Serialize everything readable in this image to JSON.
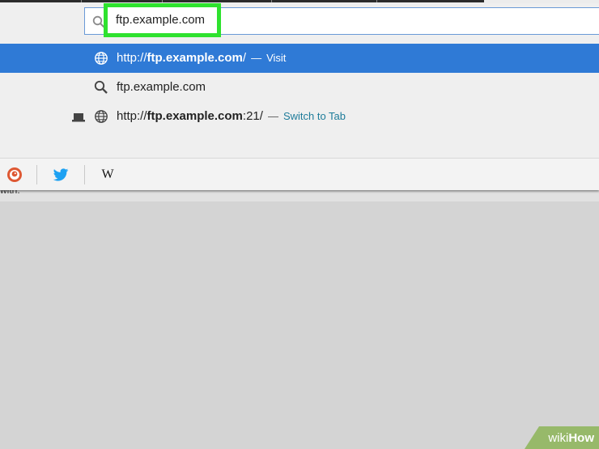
{
  "url_bar": {
    "value": "ftp.example.com",
    "icon": "search-icon"
  },
  "suggestions": [
    {
      "icon": "globe-icon",
      "prefix": "http://",
      "bold": "ftp.example.com",
      "suffix": "/",
      "separator": "—",
      "action": "Visit",
      "selected": true
    },
    {
      "icon": "search-icon",
      "text": "ftp.example.com",
      "selected": false
    },
    {
      "icon": "globe-icon",
      "extra_icon": "tab-icon",
      "prefix": "http://",
      "bold": "ftp.example.com",
      "suffix": ":21/",
      "separator": "—",
      "action": "Switch to Tab",
      "selected": false
    }
  ],
  "search_with": {
    "label": "with:",
    "engines": [
      {
        "name": "duckduckgo",
        "icon": "duckduckgo-icon"
      },
      {
        "name": "twitter",
        "icon": "twitter-bird-icon"
      },
      {
        "name": "wikipedia",
        "icon": "wikipedia-icon",
        "letter": "W"
      }
    ]
  },
  "watermark": {
    "part1": "wiki",
    "part2": "How"
  },
  "colors": {
    "selection": "#2f7ad6",
    "highlight_box": "#2ee22e",
    "switch_to_tab": "#1e7c9a",
    "twitter": "#1da1f2",
    "duckduckgo": "#de5833"
  }
}
